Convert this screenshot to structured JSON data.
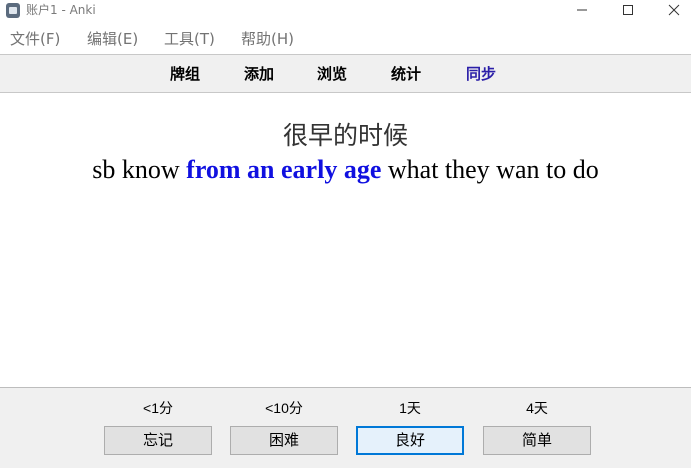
{
  "window": {
    "title": "账户1 - Anki",
    "icon": "anki-app-icon"
  },
  "menu": {
    "items": [
      {
        "label": "文件(F)"
      },
      {
        "label": "编辑(E)"
      },
      {
        "label": "工具(T)"
      },
      {
        "label": "帮助(H)"
      }
    ]
  },
  "toolbar": {
    "items": [
      {
        "label": "牌组"
      },
      {
        "label": "添加"
      },
      {
        "label": "浏览"
      },
      {
        "label": "统计"
      },
      {
        "label": "同步",
        "color": "#2b1fa8"
      }
    ]
  },
  "card": {
    "front": "很早的时候",
    "back_before": "sb know ",
    "back_highlight": "from an early age",
    "back_after": " what they wan to do",
    "highlight_color": "#1010e0"
  },
  "answer": {
    "buttons": [
      {
        "interval": "<1分",
        "label": "忘记"
      },
      {
        "interval": "<10分",
        "label": "困难"
      },
      {
        "interval": "1天",
        "label": "良好",
        "focused": true
      },
      {
        "interval": "4天",
        "label": "简单"
      }
    ]
  }
}
